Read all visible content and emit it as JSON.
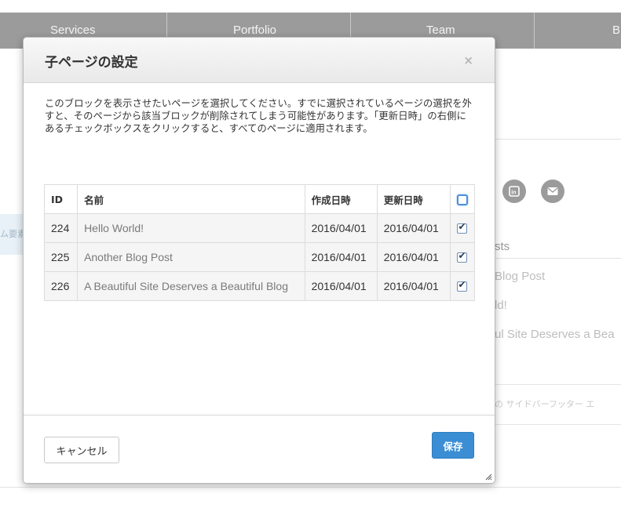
{
  "background": {
    "nav": [
      "Services",
      "Portfolio",
      "Team",
      "B"
    ],
    "left_chip": "ム要素",
    "social_icons": [
      "linkedin-icon",
      "email-icon"
    ],
    "recent_posts_heading": "sts",
    "recent_posts": [
      "Blog Post",
      "ld!",
      "ul Site Deserves a Bea"
    ],
    "footer_text": "の サイドバーフッター エ"
  },
  "modal": {
    "title": "子ページの設定",
    "close_label": "×",
    "description": "このブロックを表示させたいページを選択してください。すでに選択されているページの選択を外すと、そのページから該当ブロックが削除されてしまう可能性があります。「更新日時」の右側にあるチェックボックスをクリックすると、すべてのページに適用されます。",
    "table": {
      "headers": [
        "ID",
        "名前",
        "作成日時",
        "更新日時"
      ],
      "rows": [
        {
          "id": "224",
          "name": "Hello World!",
          "created": "2016/04/01",
          "updated": "2016/04/01",
          "checked": true
        },
        {
          "id": "225",
          "name": "Another Blog Post",
          "created": "2016/04/01",
          "updated": "2016/04/01",
          "checked": true
        },
        {
          "id": "226",
          "name": "A Beautiful Site Deserves a Beautiful Blog",
          "created": "2016/04/01",
          "updated": "2016/04/01",
          "checked": true
        }
      ]
    },
    "cancel_label": "キャンセル",
    "save_label": "保存"
  },
  "colors": {
    "nav_bg": "#9b9b9b",
    "primary_button": "#3b8ed3"
  }
}
